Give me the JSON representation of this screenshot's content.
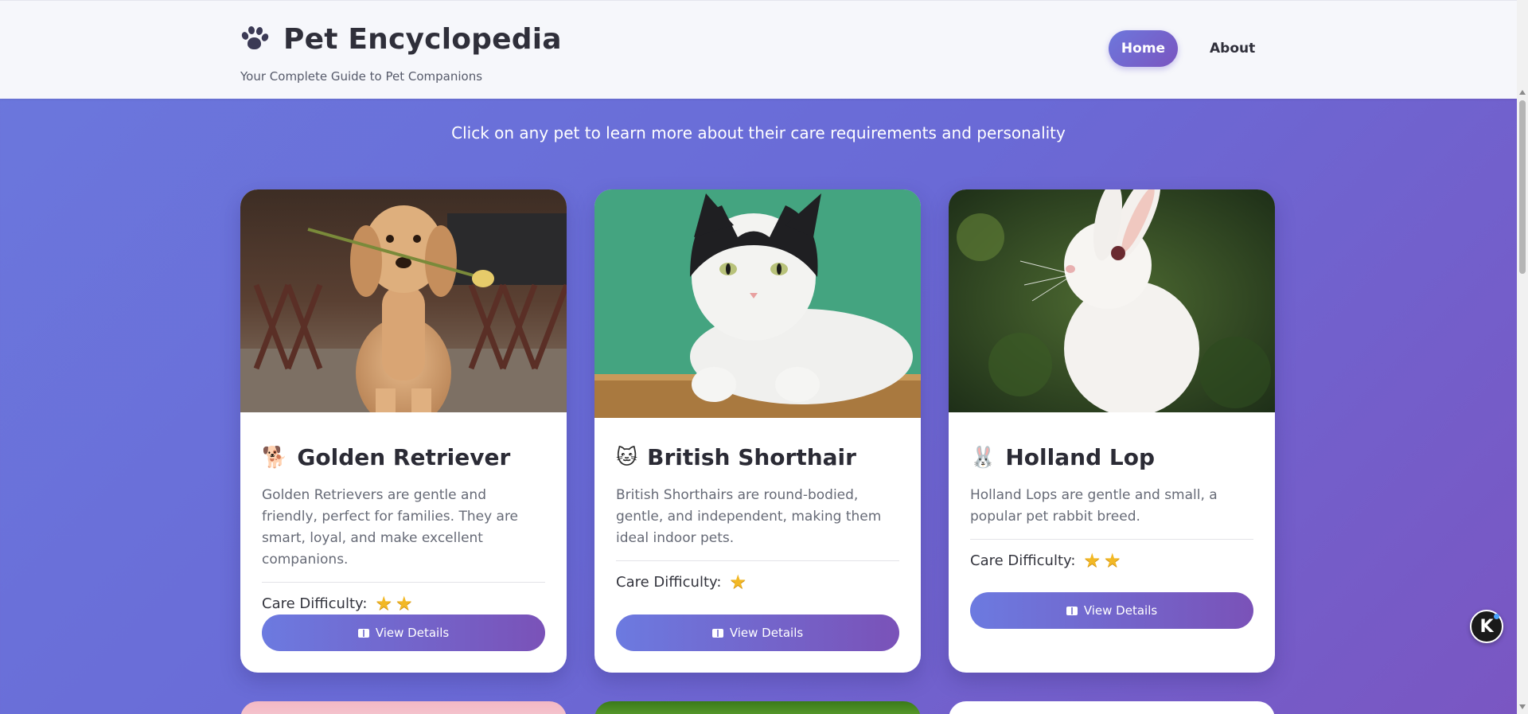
{
  "header": {
    "title": "Pet Encyclopedia",
    "subtitle": "Your Complete Guide to Pet Companions",
    "logo_icon": "paw-icon",
    "nav": [
      {
        "label": "Home",
        "active": true
      },
      {
        "label": "About",
        "active": false
      }
    ]
  },
  "intro": "Click on any pet to learn more about their care requirements and personality",
  "care_label": "Care Difficulty:",
  "cards": [
    {
      "emoji": "🐕",
      "title": "Golden Retriever",
      "description": "Golden Retrievers are gentle and friendly, perfect for families. They are smart, loyal, and make excellent companions.",
      "care_stars": 2,
      "button_label": "View Details",
      "image": "golden-retriever-photo"
    },
    {
      "emoji": "🐱",
      "title": "British Shorthair",
      "description": "British Shorthairs are round-bodied, gentle, and independent, making them ideal indoor pets.",
      "care_stars": 1,
      "button_label": "View Details",
      "image": "british-shorthair-photo"
    },
    {
      "emoji": "🐰",
      "title": "Holland Lop",
      "description": "Holland Lops are gentle and small, a popular pet rabbit breed.",
      "care_stars": 2,
      "button_label": "View Details",
      "image": "holland-lop-photo"
    }
  ],
  "floating_badge": {
    "label": "K"
  },
  "colors": {
    "accent_start": "#6c7ae0",
    "accent_end": "#7a52b8",
    "background_start": "#6b78dd",
    "background_end": "#7a56c2",
    "star": "#f2b825"
  }
}
